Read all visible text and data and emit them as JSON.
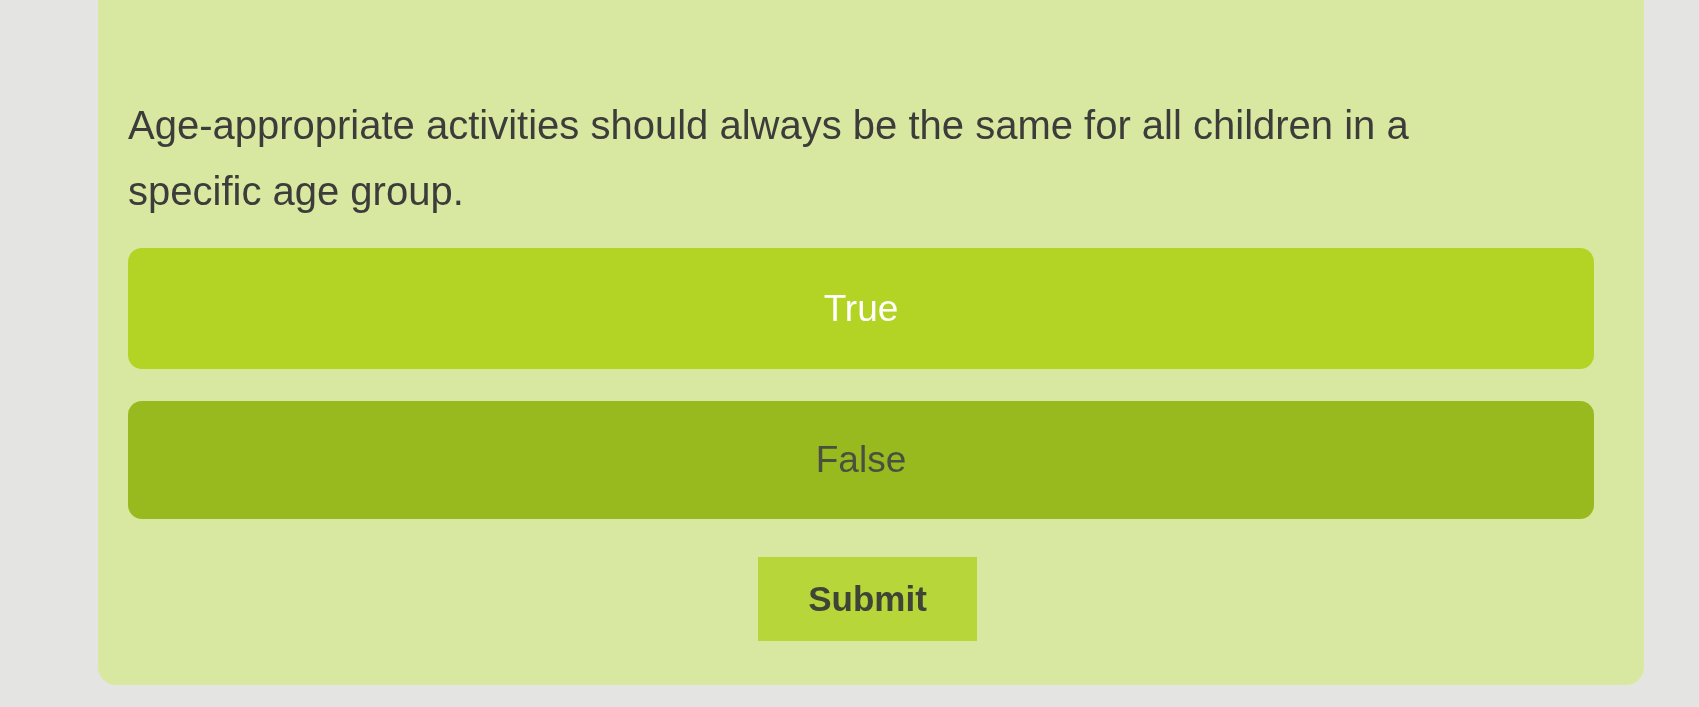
{
  "question": {
    "text": "Age-appropriate activities should always be the same for all children in a specific age group."
  },
  "options": [
    {
      "label": "True",
      "selected": false
    },
    {
      "label": "False",
      "selected": true
    }
  ],
  "submit": {
    "label": "Submit"
  }
}
